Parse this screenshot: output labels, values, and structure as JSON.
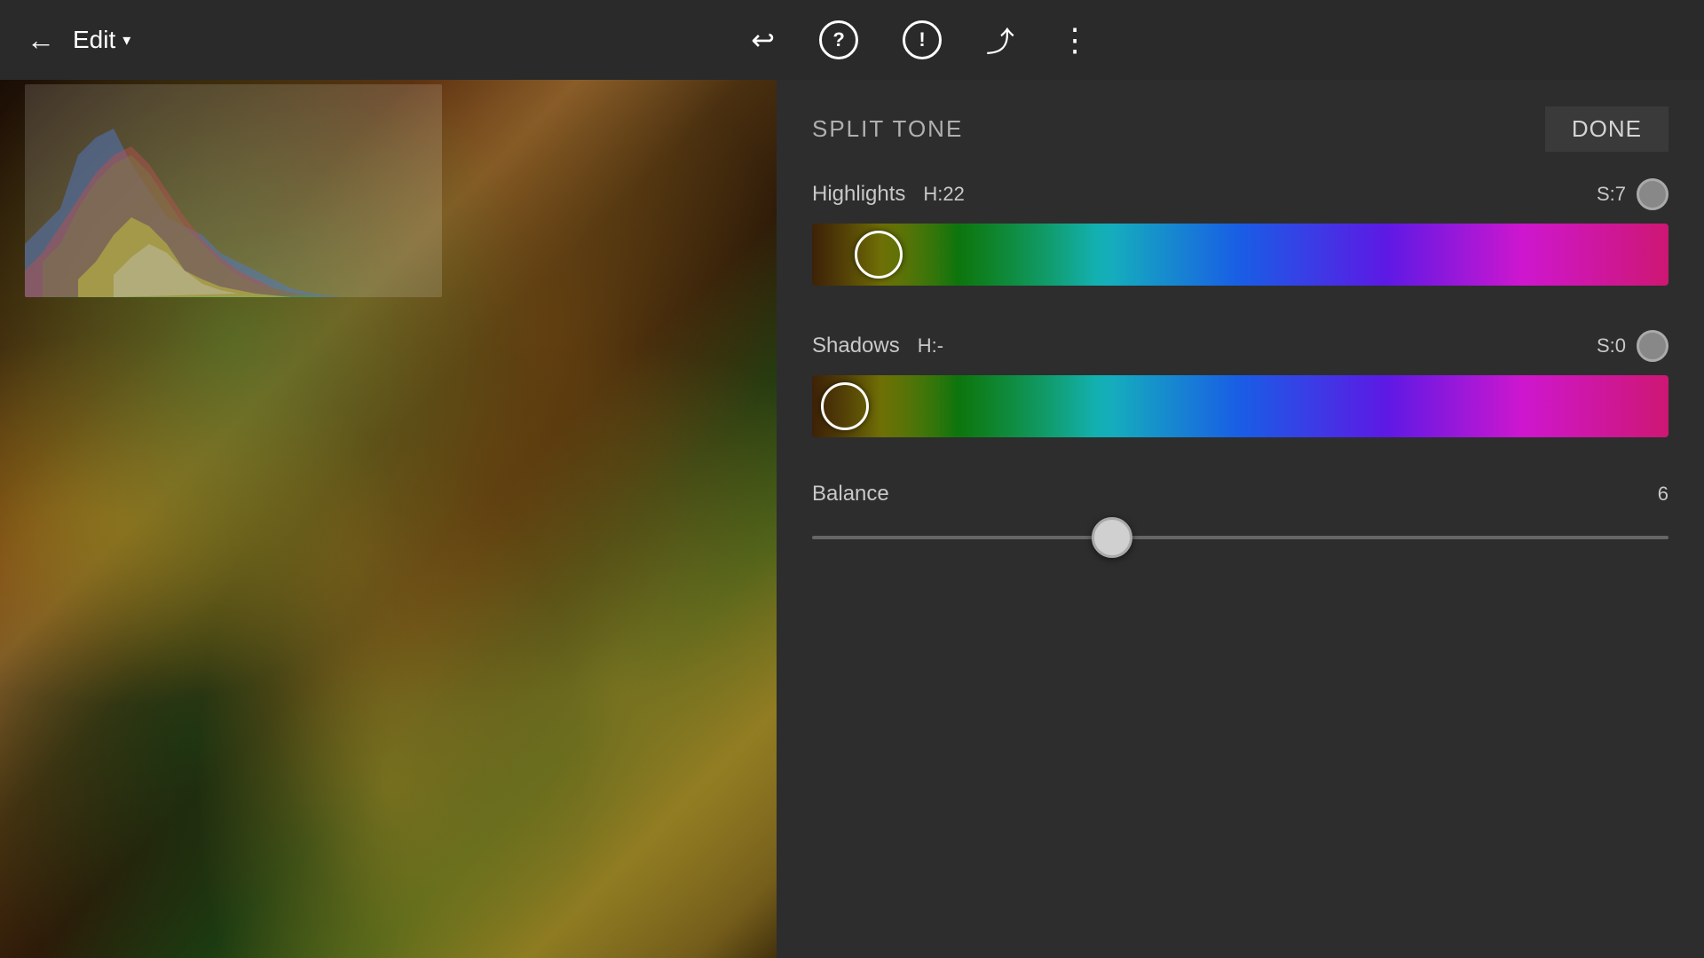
{
  "toolbar": {
    "back_icon": "←",
    "edit_label": "Edit",
    "chevron": "▾",
    "undo_icon": "↩",
    "help_icon": "?",
    "warning_icon": "!",
    "share_icon": "⤴",
    "more_icon": "⋮"
  },
  "panel": {
    "title": "SPLIT TONE",
    "done_label": "DONE"
  },
  "highlights": {
    "label": "Highlights",
    "hue_label": "H:22",
    "saturation_label": "S:7",
    "handle_left_percent": 8
  },
  "shadows": {
    "label": "Shadows",
    "hue_label": "H:-",
    "saturation_label": "S:0",
    "handle_left_percent": 3
  },
  "balance": {
    "label": "Balance",
    "value": "6",
    "thumb_left_percent": 35
  },
  "colors": {
    "accent": "#c8a060",
    "bg_dark": "#2d2d2d",
    "toolbar_bg": "#2a2a2a"
  }
}
